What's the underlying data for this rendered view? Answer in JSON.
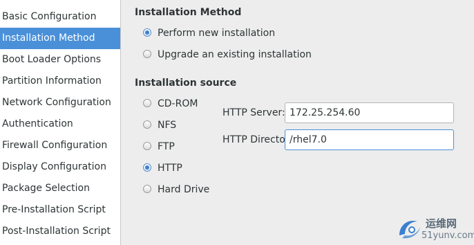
{
  "sidebar": {
    "items": [
      {
        "label": "Basic Configuration",
        "selected": false
      },
      {
        "label": "Installation Method",
        "selected": true
      },
      {
        "label": "Boot Loader Options",
        "selected": false
      },
      {
        "label": "Partition Information",
        "selected": false
      },
      {
        "label": "Network Configuration",
        "selected": false
      },
      {
        "label": "Authentication",
        "selected": false
      },
      {
        "label": "Firewall Configuration",
        "selected": false
      },
      {
        "label": "Display Configuration",
        "selected": false
      },
      {
        "label": "Package Selection",
        "selected": false
      },
      {
        "label": "Pre-Installation Script",
        "selected": false
      },
      {
        "label": "Post-Installation Script",
        "selected": false
      }
    ]
  },
  "method": {
    "title": "Installation Method",
    "options": [
      {
        "label": "Perform new installation",
        "checked": true
      },
      {
        "label": "Upgrade an existing installation",
        "checked": false
      }
    ]
  },
  "source": {
    "title": "Installation source",
    "options": [
      {
        "label": "CD-ROM",
        "checked": false
      },
      {
        "label": "NFS",
        "checked": false
      },
      {
        "label": "FTP",
        "checked": false
      },
      {
        "label": "HTTP",
        "checked": true
      },
      {
        "label": "Hard Drive",
        "checked": false
      }
    ],
    "http_server_label": "HTTP Server:",
    "http_server_value": "172.25.254.60",
    "http_directory_label": "HTTP Directory:",
    "http_directory_value": "/rhel7.0"
  },
  "watermark": {
    "chinese": "运维网",
    "url": "51yunv.com"
  },
  "colors": {
    "selection": "#4a90d9",
    "radio_dot": "#3d7fcf",
    "background": "#ededed"
  }
}
